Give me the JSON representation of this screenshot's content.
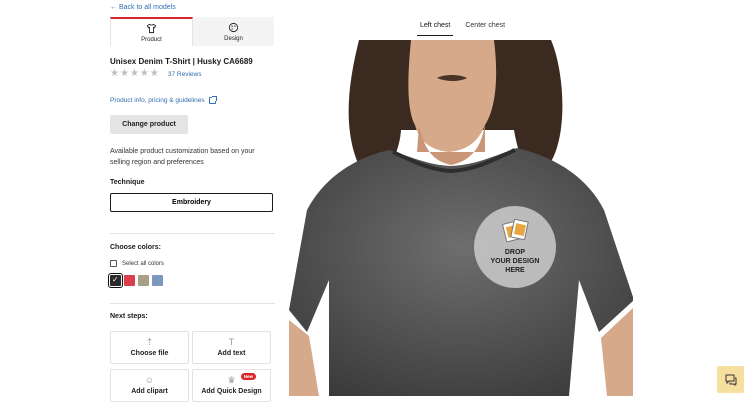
{
  "nav": {
    "back_link": "← Back to all models"
  },
  "tabs": [
    {
      "label": "Product",
      "icon": "tshirt-icon",
      "active": true
    },
    {
      "label": "Design",
      "icon": "palette-icon",
      "active": false
    }
  ],
  "product": {
    "title": "Unisex Denim T-Shirt | Husky CA6689",
    "rating": 0,
    "rating_max": 5,
    "reviews": "37 Reviews",
    "info_link": "Product info, pricing & guidelines",
    "change_button": "Change product",
    "availability_text": "Available product customization based on your selling region and preferences"
  },
  "technique": {
    "label": "Technique",
    "value": "Embroidery"
  },
  "colors": {
    "label": "Choose colors:",
    "select_all": "Select all colors",
    "swatches": [
      {
        "name": "black-denim",
        "hex": "#2b2b2b",
        "selected": true
      },
      {
        "name": "red",
        "hex": "#d9404a",
        "selected": false
      },
      {
        "name": "olive",
        "hex": "#a79f86",
        "selected": false
      },
      {
        "name": "blue",
        "hex": "#7d98bf",
        "selected": false
      }
    ]
  },
  "next_steps": {
    "label": "Next steps:",
    "buttons": [
      {
        "label": "Choose file",
        "icon": "upload-icon"
      },
      {
        "label": "Add text",
        "icon": "text-icon"
      },
      {
        "label": "Add clipart",
        "icon": "smiley-icon"
      },
      {
        "label": "Add Quick Design",
        "icon": "crown-icon",
        "badge": "New"
      }
    ]
  },
  "placement": {
    "tabs": [
      "Left chest",
      "Center chest"
    ],
    "active": "Left chest"
  },
  "drop_zone": {
    "line1": "DROP",
    "line2": "YOUR DESIGN",
    "line3": "HERE"
  },
  "colors_theme": {
    "accent": "#d9252a",
    "link": "#2f6fb3",
    "chat": "#f7dfa0"
  }
}
